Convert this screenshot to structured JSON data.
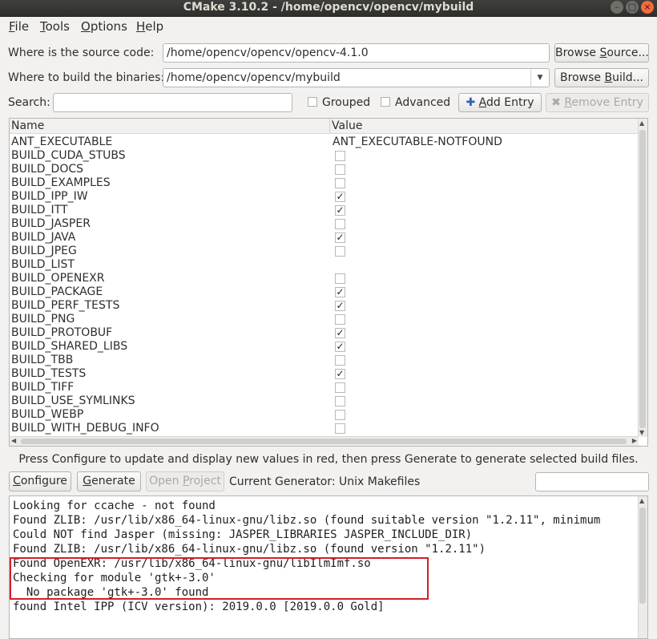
{
  "window": {
    "title": "CMake 3.10.2 - /home/opencv/opencv/mybuild",
    "minimize_glyph": "–",
    "maximize_glyph": "□",
    "close_glyph": "×"
  },
  "menu": {
    "file": {
      "mn": "F",
      "rest": "ile"
    },
    "tools": {
      "mn": "T",
      "rest": "ools"
    },
    "options": {
      "mn": "O",
      "rest": "ptions"
    },
    "help": {
      "mn": "H",
      "rest": "elp"
    }
  },
  "source": {
    "label": "Where is the source code:",
    "value": "/home/opencv/opencv/opencv-4.1.0",
    "browse": {
      "pre": "Browse ",
      "mn": "S",
      "post": "ource..."
    }
  },
  "build": {
    "label": "Where to build the binaries:",
    "value": "/home/opencv/opencv/mybuild",
    "browse": {
      "pre": "Browse ",
      "mn": "B",
      "post": "uild..."
    }
  },
  "search": {
    "label": "Search:",
    "value": "",
    "grouped_label": "Grouped",
    "advanced_label": "Advanced",
    "add_entry": {
      "mn": "A",
      "rest": "dd Entry"
    },
    "remove_entry": {
      "mn": "R",
      "rest": "emove Entry"
    }
  },
  "table": {
    "col_name": "Name",
    "col_value": "Value",
    "rows": [
      {
        "name": "ANT_EXECUTABLE",
        "value": "ANT_EXECUTABLE-NOTFOUND"
      },
      {
        "name": "BUILD_CUDA_STUBS",
        "check": ""
      },
      {
        "name": "BUILD_DOCS",
        "check": ""
      },
      {
        "name": "BUILD_EXAMPLES",
        "check": ""
      },
      {
        "name": "BUILD_IPP_IW",
        "check": "✓"
      },
      {
        "name": "BUILD_ITT",
        "check": "✓"
      },
      {
        "name": "BUILD_JASPER",
        "check": ""
      },
      {
        "name": "BUILD_JAVA",
        "check": "✓"
      },
      {
        "name": "BUILD_JPEG",
        "check": ""
      },
      {
        "name": "BUILD_LIST",
        "value": ""
      },
      {
        "name": "BUILD_OPENEXR",
        "check": ""
      },
      {
        "name": "BUILD_PACKAGE",
        "check": "✓"
      },
      {
        "name": "BUILD_PERF_TESTS",
        "check": "✓"
      },
      {
        "name": "BUILD_PNG",
        "check": ""
      },
      {
        "name": "BUILD_PROTOBUF",
        "check": "✓"
      },
      {
        "name": "BUILD_SHARED_LIBS",
        "check": "✓"
      },
      {
        "name": "BUILD_TBB",
        "check": ""
      },
      {
        "name": "BUILD_TESTS",
        "check": "✓"
      },
      {
        "name": "BUILD_TIFF",
        "check": ""
      },
      {
        "name": "BUILD_USE_SYMLINKS",
        "check": ""
      },
      {
        "name": "BUILD_WEBP",
        "check": ""
      },
      {
        "name": "BUILD_WITH_DEBUG_INFO",
        "check": ""
      }
    ]
  },
  "hint": "Press Configure to update and display new values in red, then press Generate to generate selected build files.",
  "actions": {
    "configure": {
      "mn": "C",
      "rest": "onfigure"
    },
    "generate": {
      "mn": "G",
      "rest": "enerate"
    },
    "open_project": {
      "pre": "Open ",
      "mn": "P",
      "post": "roject"
    },
    "generator_label": "Current Generator: Unix Makefiles"
  },
  "output": {
    "lines": [
      "Looking for ccache - not found",
      "Found ZLIB: /usr/lib/x86_64-linux-gnu/libz.so (found suitable version \"1.2.11\", minimum",
      "Could NOT find Jasper (missing: JASPER_LIBRARIES JASPER_INCLUDE_DIR)",
      "Found ZLIB: /usr/lib/x86_64-linux-gnu/libz.so (found version \"1.2.11\")",
      "Found OpenEXR: /usr/lib/x86_64-linux-gnu/libIlmImf.so",
      "Checking for module 'gtk+-3.0'",
      "  No package 'gtk+-3.0' found",
      "found Intel IPP (ICV version): 2019.0.0 [2019.0.0 Gold]"
    ]
  },
  "colors": {
    "highlight": "#d2202a",
    "close_button": "#f36b41"
  }
}
